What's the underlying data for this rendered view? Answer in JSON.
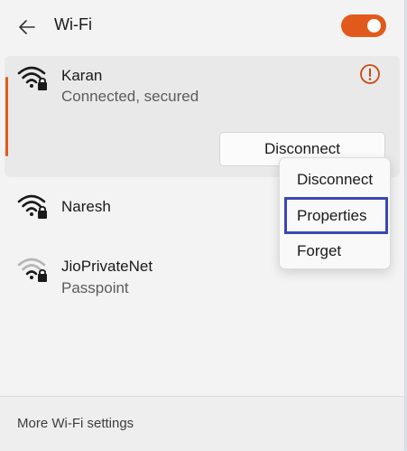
{
  "header": {
    "title": "Wi-Fi",
    "wifi_enabled": true,
    "accent_color": "#e25a1b"
  },
  "networks": [
    {
      "name": "Karan",
      "status": "Connected, secured",
      "icon": "wifi-secured-icon",
      "signal": "full",
      "selected": true
    },
    {
      "name": "Naresh",
      "icon": "wifi-secured-icon",
      "signal": "full"
    },
    {
      "name": "JioPrivateNet",
      "status": "Passpoint",
      "icon": "wifi-secured-icon",
      "signal": "weak"
    }
  ],
  "selected_network": {
    "disconnect_label": "Disconnect",
    "info_icon": "info-icon"
  },
  "context_menu": {
    "items": [
      {
        "label": "Disconnect"
      },
      {
        "label": "Properties",
        "highlighted": true
      },
      {
        "label": "Forget"
      }
    ],
    "highlight_color": "#3a47b5"
  },
  "footer": {
    "link": "More Wi-Fi settings"
  }
}
